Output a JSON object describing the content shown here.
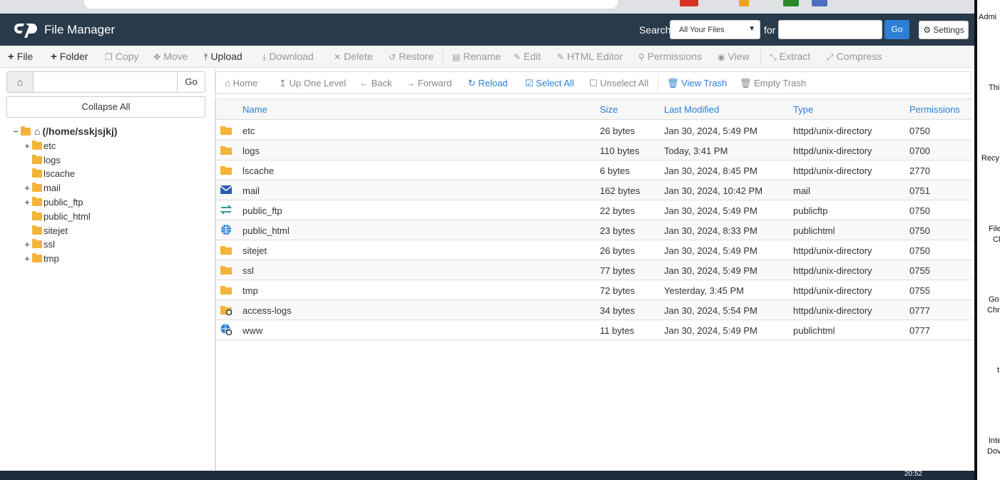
{
  "header": {
    "app_title": "File Manager",
    "search_label": "Search",
    "search_scope": "All Your Files",
    "for_label": "for",
    "search_value": "",
    "go_label": "Go",
    "settings_label": "Settings"
  },
  "toolbar": {
    "items": [
      {
        "label": "File",
        "icon": "plus-icon",
        "enabled": true
      },
      {
        "label": "Folder",
        "icon": "plus-icon",
        "enabled": true
      },
      {
        "label": "Copy",
        "icon": "copy-icon",
        "enabled": false
      },
      {
        "label": "Move",
        "icon": "move-icon",
        "enabled": false
      },
      {
        "label": "Upload",
        "icon": "upload-icon",
        "enabled": true
      },
      {
        "label": "Download",
        "icon": "download-icon",
        "enabled": false
      },
      {
        "label": "Delete",
        "icon": "delete-icon",
        "enabled": false
      },
      {
        "label": "Restore",
        "icon": "restore-icon",
        "enabled": false
      },
      {
        "label": "Rename",
        "icon": "rename-icon",
        "enabled": false
      },
      {
        "label": "Edit",
        "icon": "pencil-icon",
        "enabled": false
      },
      {
        "label": "HTML Editor",
        "icon": "html-editor-icon",
        "enabled": false
      },
      {
        "label": "Permissions",
        "icon": "key-icon",
        "enabled": false
      },
      {
        "label": "View",
        "icon": "eye-icon",
        "enabled": false
      },
      {
        "label": "Extract",
        "icon": "extract-icon",
        "enabled": false
      },
      {
        "label": "Compress",
        "icon": "compress-icon",
        "enabled": false
      }
    ]
  },
  "sidebar": {
    "path_value": "",
    "go_label": "Go",
    "collapse_label": "Collapse All",
    "root_label": "(/home/sskjsjkj)",
    "tree": [
      {
        "label": "etc",
        "expandable": true
      },
      {
        "label": "logs",
        "expandable": false
      },
      {
        "label": "lscache",
        "expandable": false
      },
      {
        "label": "mail",
        "expandable": true
      },
      {
        "label": "public_ftp",
        "expandable": true
      },
      {
        "label": "public_html",
        "expandable": false
      },
      {
        "label": "sitejet",
        "expandable": false
      },
      {
        "label": "ssl",
        "expandable": true
      },
      {
        "label": "tmp",
        "expandable": true
      }
    ]
  },
  "nav": {
    "home": "Home",
    "up": "Up One Level",
    "back": "Back",
    "forward": "Forward",
    "reload": "Reload",
    "select_all": "Select All",
    "unselect_all": "Unselect All",
    "view_trash": "View Trash",
    "empty_trash": "Empty Trash"
  },
  "grid": {
    "columns": [
      "Name",
      "Size",
      "Last Modified",
      "Type",
      "Permissions"
    ],
    "rows": [
      {
        "icon": "folder-icon",
        "name": "etc",
        "size": "26 bytes",
        "modified": "Jan 30, 2024, 5:49 PM",
        "type": "httpd/unix-directory",
        "perms": "0750"
      },
      {
        "icon": "folder-icon",
        "name": "logs",
        "size": "110 bytes",
        "modified": "Today, 3:41 PM",
        "type": "httpd/unix-directory",
        "perms": "0700"
      },
      {
        "icon": "folder-icon",
        "name": "lscache",
        "size": "6 bytes",
        "modified": "Jan 30, 2024, 8:45 PM",
        "type": "httpd/unix-directory",
        "perms": "2770"
      },
      {
        "icon": "mail-icon",
        "name": "mail",
        "size": "162 bytes",
        "modified": "Jan 30, 2024, 10:42 PM",
        "type": "mail",
        "perms": "0751"
      },
      {
        "icon": "ftp-arrows-icon",
        "name": "public_ftp",
        "size": "22 bytes",
        "modified": "Jan 30, 2024, 5:49 PM",
        "type": "publicftp",
        "perms": "0750"
      },
      {
        "icon": "globe-icon",
        "name": "public_html",
        "size": "23 bytes",
        "modified": "Jan 30, 2024, 8:33 PM",
        "type": "publichtml",
        "perms": "0750"
      },
      {
        "icon": "folder-icon",
        "name": "sitejet",
        "size": "26 bytes",
        "modified": "Jan 30, 2024, 5:49 PM",
        "type": "httpd/unix-directory",
        "perms": "0750"
      },
      {
        "icon": "folder-icon",
        "name": "ssl",
        "size": "77 bytes",
        "modified": "Jan 30, 2024, 5:49 PM",
        "type": "httpd/unix-directory",
        "perms": "0755"
      },
      {
        "icon": "folder-icon",
        "name": "tmp",
        "size": "72 bytes",
        "modified": "Yesterday, 3:45 PM",
        "type": "httpd/unix-directory",
        "perms": "0755"
      },
      {
        "icon": "folder-link-icon",
        "name": "access-logs",
        "size": "34 bytes",
        "modified": "Jan 30, 2024, 5:54 PM",
        "type": "httpd/unix-directory",
        "perms": "0777"
      },
      {
        "icon": "globe-link-icon",
        "name": "www",
        "size": "11 bytes",
        "modified": "Jan 30, 2024, 5:49 PM",
        "type": "publichtml",
        "perms": "0777"
      }
    ]
  },
  "taskbar": {
    "clock": "20:52"
  },
  "desktop": {
    "labels": [
      "Admi",
      "Thi",
      "Recy",
      "File",
      "Cl",
      "Go",
      "Chr",
      "t",
      "Inte",
      "Dov"
    ]
  },
  "colors": {
    "header_bg": "#293a4a",
    "accent": "#2b7fd4",
    "folder": "#f3b43a"
  }
}
